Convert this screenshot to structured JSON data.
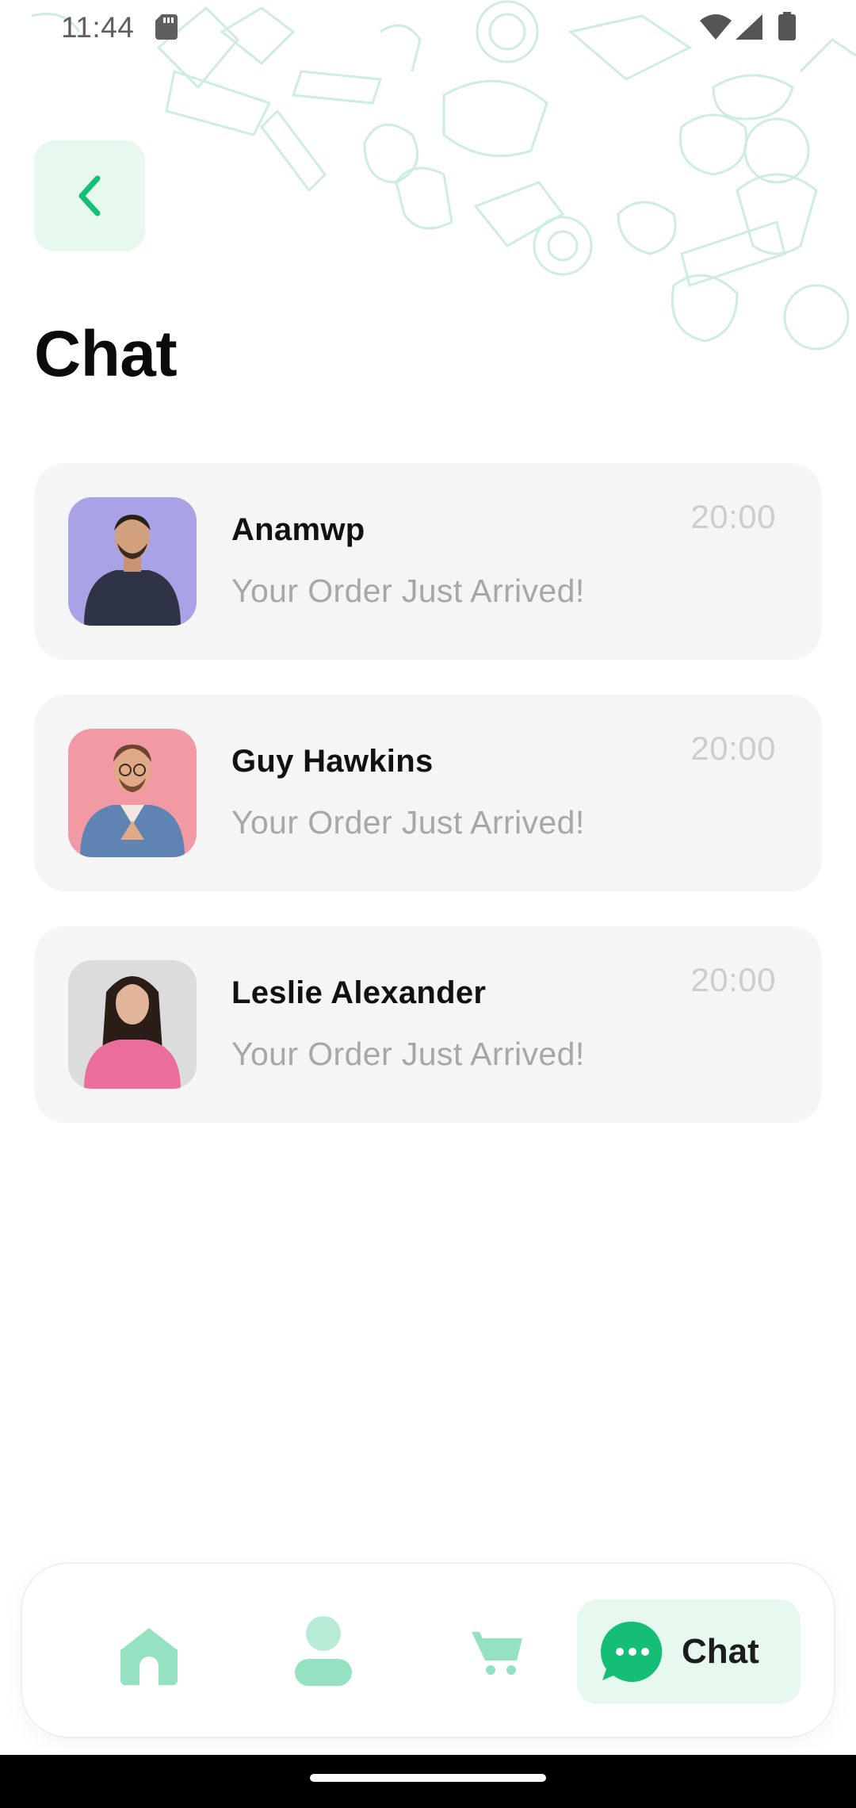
{
  "status_bar": {
    "time": "11:44",
    "icons": [
      "sd-card-icon",
      "wifi-icon",
      "signal-icon",
      "battery-icon"
    ]
  },
  "header": {
    "back_icon": "chevron-left-icon",
    "title": "Chat"
  },
  "chats": [
    {
      "name": "Anamwp",
      "message": "Your Order Just Arrived!",
      "time": "20:00",
      "avatar_bg": "#a9a2e6"
    },
    {
      "name": "Guy Hawkins",
      "message": "Your Order Just Arrived!",
      "time": "20:00",
      "avatar_bg": "#f29aa3"
    },
    {
      "name": "Leslie Alexander",
      "message": "Your Order Just Arrived!",
      "time": "20:00",
      "avatar_bg": "#dcdcdc"
    }
  ],
  "bottom_nav": {
    "items": [
      {
        "icon": "home-icon",
        "label": ""
      },
      {
        "icon": "profile-icon",
        "label": ""
      },
      {
        "icon": "cart-icon",
        "label": ""
      },
      {
        "icon": "chat-bubble-icon",
        "label": "Chat",
        "active": true
      }
    ]
  },
  "colors": {
    "accent": "#15be77",
    "accent_light": "#e7f8ef",
    "doodle": "#d6f3e4",
    "card_bg": "#f5f5f5",
    "muted_text": "#a7a7a7"
  }
}
